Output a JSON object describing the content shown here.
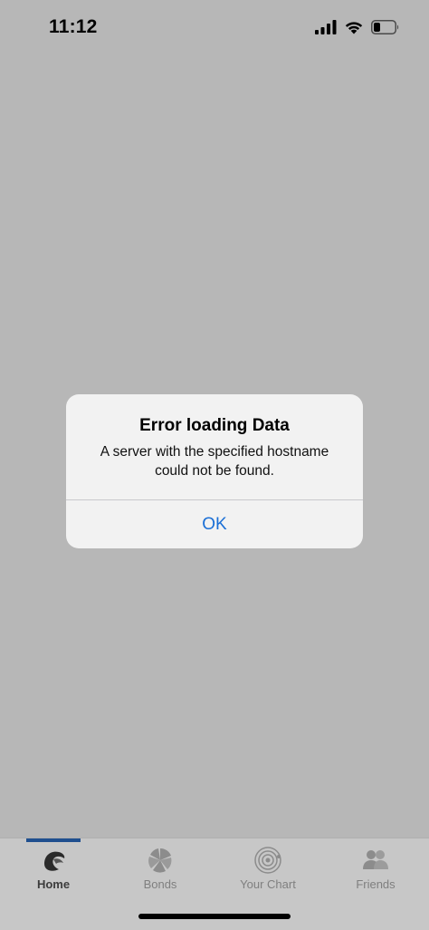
{
  "status_bar": {
    "time": "11:12",
    "icons": [
      "cellular-signal-icon",
      "wifi-icon",
      "battery-icon"
    ]
  },
  "alert": {
    "title": "Error loading Data",
    "message_line1": "A server with the specified hostname",
    "message_line2": "could not be found.",
    "ok_label": "OK",
    "accent_color": "#1a6fd6"
  },
  "tab_bar": {
    "active_tab": "Home",
    "active_color": "#1f4f8f",
    "tabs": [
      {
        "label": "Home",
        "icon": "home-logo-icon"
      },
      {
        "label": "Bonds",
        "icon": "bonds-icon"
      },
      {
        "label": "Your Chart",
        "icon": "chart-wheel-icon"
      },
      {
        "label": "Friends",
        "icon": "friends-icon"
      }
    ]
  }
}
